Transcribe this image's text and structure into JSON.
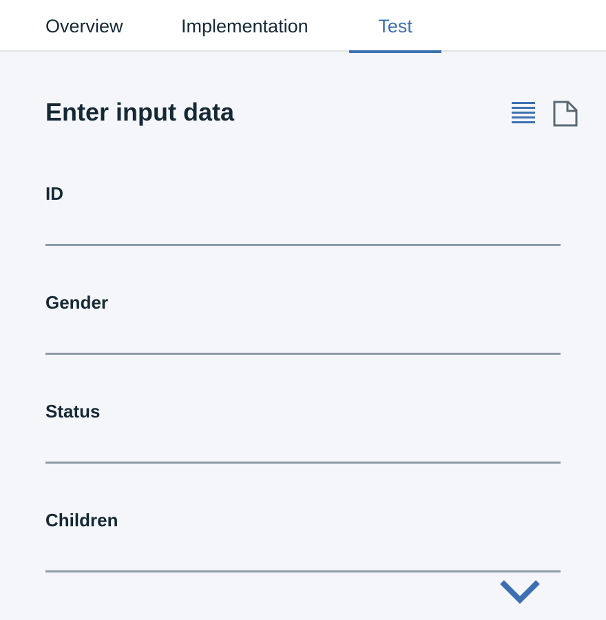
{
  "tabs": {
    "overview": "Overview",
    "implementation": "Implementation",
    "test": "Test",
    "active": "Test"
  },
  "panel": {
    "title": "Enter input data",
    "icons": {
      "list": "list-view-icon",
      "file": "file-view-icon"
    }
  },
  "fields": [
    {
      "label": "ID",
      "value": "",
      "placeholder": ""
    },
    {
      "label": "Gender",
      "value": "",
      "placeholder": ""
    },
    {
      "label": "Status",
      "value": "",
      "placeholder": ""
    },
    {
      "label": "Children",
      "value": "",
      "placeholder": ""
    }
  ],
  "scroll": {
    "icon": "chevron-down-icon"
  },
  "colors": {
    "accent": "#3d70b2",
    "text": "#152935",
    "background": "#f4f6fa",
    "input_border": "#8c9ba5",
    "icon_gray": "#5a6872"
  }
}
